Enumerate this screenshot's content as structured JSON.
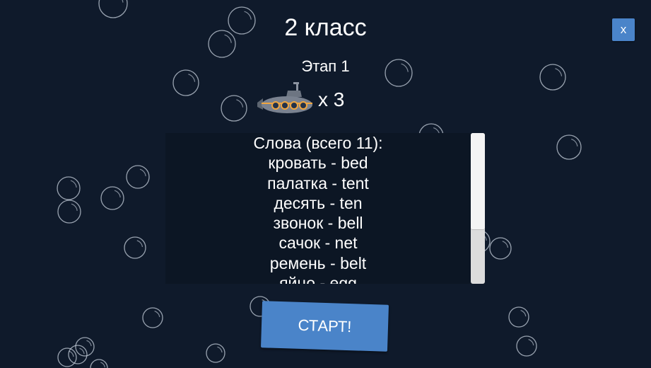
{
  "header": {
    "grade_title": "2 класс",
    "stage_label": "Этап 1",
    "close_label": "x"
  },
  "lives": {
    "icon": "submarine-icon",
    "count_label": "x 3"
  },
  "words": {
    "heading": "Слова (всего 11):",
    "items": [
      "кровать - bed",
      "палатка - tent",
      "десять - ten",
      "звонок - bell",
      "сачок - net",
      "ремень - belt",
      "яйцо - egg"
    ]
  },
  "start_label": "СТАРТ!",
  "colors": {
    "background": "#0f1a2b",
    "button": "#4a84c9",
    "submarine_body": "#7a8290",
    "submarine_lights": "#f0a640"
  }
}
